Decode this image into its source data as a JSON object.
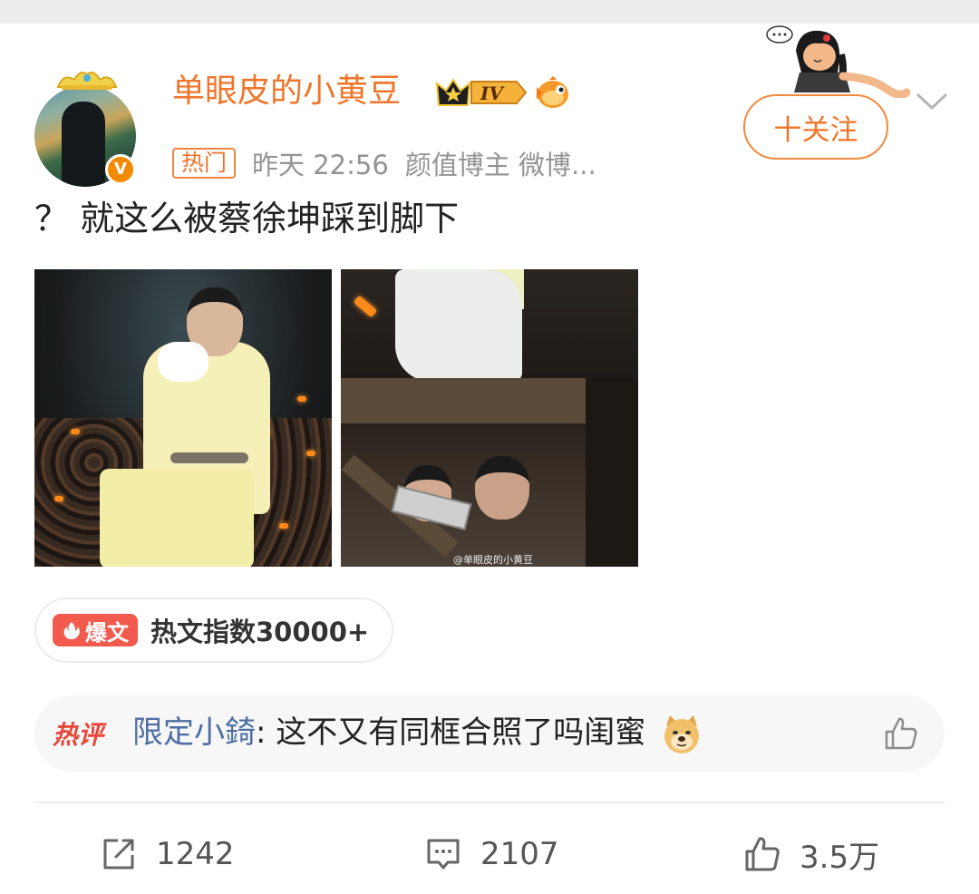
{
  "post": {
    "username": "单眼皮的小黄豆",
    "level_badge": "IV",
    "hot_tag": "热门",
    "time": "昨天 22:56",
    "source": "颜值博主 微博...",
    "follow_label": "十关注",
    "text": "？ 就这么被蔡徐坤踩到脚下",
    "watermark": "@单眼皮的小黄豆"
  },
  "hot_index": {
    "badge": "爆文",
    "text": "热文指数30000+"
  },
  "hot_comment": {
    "tag": "热评",
    "commenter": "限定小錡",
    "separator": ": ",
    "text": "这不又有同框合照了吗闺蜜",
    "emoji": "doge-emoji"
  },
  "actions": {
    "share_count": "1242",
    "comment_count": "2107",
    "like_count": "3.5万"
  },
  "colors": {
    "username": "#f0752a",
    "accent": "#f28a3c",
    "commenter": "#4d6ea3",
    "hot": "#e8463a"
  }
}
